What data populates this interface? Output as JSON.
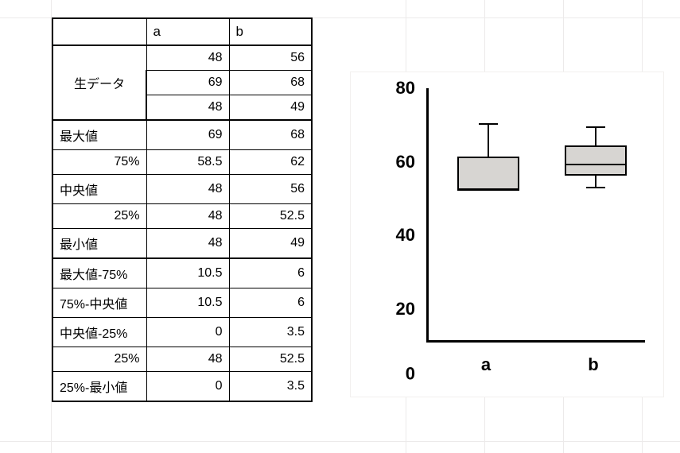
{
  "table": {
    "headers": {
      "col_a": "a",
      "col_b": "b"
    },
    "raw_label": "生データ",
    "raw": {
      "a": [
        48,
        69,
        48
      ],
      "b": [
        56,
        68,
        49
      ]
    },
    "stats": {
      "max": {
        "label": "最大値",
        "a": 69,
        "b": 68
      },
      "p75": {
        "label": "75%",
        "a": 58.5,
        "b": 62
      },
      "median": {
        "label": "中央値",
        "a": 48,
        "b": 56
      },
      "p25": {
        "label": "25%",
        "a": 48,
        "b": 52.5
      },
      "min": {
        "label": "最小値",
        "a": 48,
        "b": 49
      }
    },
    "diffs": {
      "max_p75": {
        "label": "最大値-75%",
        "a": 10.5,
        "b": 6
      },
      "p75_median": {
        "label": "75%-中央値",
        "a": 10.5,
        "b": 6
      },
      "median_p25": {
        "label": "中央値-25%",
        "a": 0,
        "b": 3.5
      },
      "p25_val": {
        "label": "25%",
        "a": 48,
        "b": 52.5
      },
      "p25_min": {
        "label": "25%-最小値",
        "a": 0,
        "b": 3.5
      }
    }
  },
  "chart_data": {
    "type": "box",
    "categories": [
      "a",
      "b"
    ],
    "series": [
      {
        "name": "a",
        "min": 48,
        "q1": 48,
        "median": 48,
        "q3": 58.5,
        "max": 69
      },
      {
        "name": "b",
        "min": 49,
        "q1": 52.5,
        "median": 56,
        "q3": 62,
        "max": 68
      }
    ],
    "yticks": [
      0,
      20,
      40,
      60,
      80
    ],
    "ylim": [
      0,
      80
    ],
    "xlabel": "",
    "ylabel": "",
    "title": ""
  },
  "colors": {
    "box_fill": "#d7d5d2",
    "axis": "#000000"
  }
}
